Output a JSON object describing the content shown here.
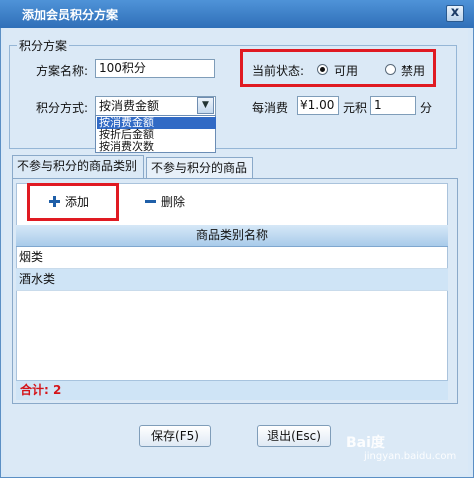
{
  "window": {
    "title": "添加会员积分方案",
    "close_glyph": "x"
  },
  "plan": {
    "group_label": "积分方案",
    "name_label": "方案名称:",
    "name_value": "100积分",
    "status_label": "当前状态:",
    "status_options": [
      "可用",
      "禁用"
    ],
    "status_selected": "可用",
    "method_label": "积分方式:",
    "method_value": "按消费金额",
    "method_options": [
      "按消费金额",
      "按折后金额",
      "按消费次数"
    ],
    "method_highlighted": "按消费金额",
    "per_label": "每消费",
    "amount_value": "¥1.00",
    "unit_label": "元积",
    "points_value": "1",
    "points_unit": "分"
  },
  "tabs": [
    {
      "label": "不参与积分的商品类别",
      "active": true
    },
    {
      "label": "不参与积分的商品",
      "active": false
    }
  ],
  "toolbar": {
    "add_label": "添加",
    "delete_label": "删除"
  },
  "grid": {
    "column_header": "商品类别名称",
    "rows": [
      "烟类",
      "酒水类"
    ],
    "footer": "合计: 2"
  },
  "buttons": {
    "save_label": "保存(F5)",
    "exit_label": "退出(Esc)"
  },
  "watermark": {
    "brand": "Bai度",
    "sub": "jingyan.baidu.com"
  },
  "colors": {
    "title_bar": "#2f6fb8",
    "highlight": "#e01a22",
    "selection": "#316ac5"
  }
}
